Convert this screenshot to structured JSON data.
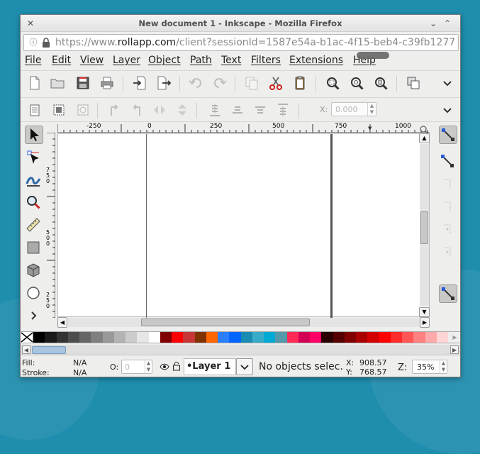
{
  "window": {
    "title": "New document 1 - Inkscape - Mozilla Firefox",
    "url_base": "https://www.",
    "url_host": "rollapp.com",
    "url_rest": "/client?sessionId=1587e54a-b1ac-4f15-beb4-c39fb1277"
  },
  "menu": [
    "File",
    "Edit",
    "View",
    "Layer",
    "Object",
    "Path",
    "Text",
    "Filters",
    "Extensions",
    "Help"
  ],
  "toolbar": {
    "commands": [
      "new-document-icon",
      "open-icon",
      "save-icon",
      "print-icon",
      "import-icon",
      "export-icon",
      "undo-icon",
      "redo-icon",
      "duplicate-icon",
      "cut-icon",
      "paste-icon",
      "zoom-selection-icon",
      "zoom-drawing-icon",
      "zoom-page-icon",
      "object-properties-icon",
      "more-chevron-icon"
    ],
    "x_label": "X:",
    "x_value": "0.000"
  },
  "ruler": {
    "h_labels": [
      "-250",
      "0",
      "250",
      "500",
      "750",
      "1000"
    ],
    "v_labels": [
      "7",
      "5",
      "0",
      "5",
      "0",
      "0",
      "2",
      "5",
      "0"
    ]
  },
  "tools": [
    "selector-tool",
    "node-tool",
    "tweak-tool",
    "zoom-tool",
    "measure-tool",
    "rectangle-tool",
    "3d-box-tool",
    "ellipse-tool",
    "expand-tools"
  ],
  "palette": {
    "colors": [
      "#000000",
      "#1a1a1a",
      "#333333",
      "#4d4d4d",
      "#666666",
      "#808080",
      "#999999",
      "#b3b3b3",
      "#cccccc",
      "#e6e6e6",
      "#ffffff",
      "#800000",
      "#ff0000",
      "#c83737",
      "#803300",
      "#ff6600",
      "#2a7fff",
      "#0066ff",
      "#1a8cb2",
      "#37abc8",
      "#00aad4",
      "#5599aa",
      "#ff2a55",
      "#d40055",
      "#ff0066",
      "#2b0000",
      "#550000",
      "#800000",
      "#aa0000",
      "#d40000",
      "#ff0000",
      "#ff2a2a",
      "#ff5555",
      "#ff8080",
      "#ffaaaa",
      "#ffd5d5"
    ]
  },
  "status": {
    "fill_label": "Fill:",
    "fill_value": "N/A",
    "stroke_label": "Stroke:",
    "stroke_value": "N/A",
    "opacity_label": "O:",
    "opacity_value": "0",
    "layer_name": "•Layer 1",
    "message": "No objects selec.",
    "x_label": "X:",
    "x_value": "908.57",
    "y_label": "Y:",
    "y_value": "768.57",
    "zoom_label": "Z:",
    "zoom_value": "35%"
  }
}
